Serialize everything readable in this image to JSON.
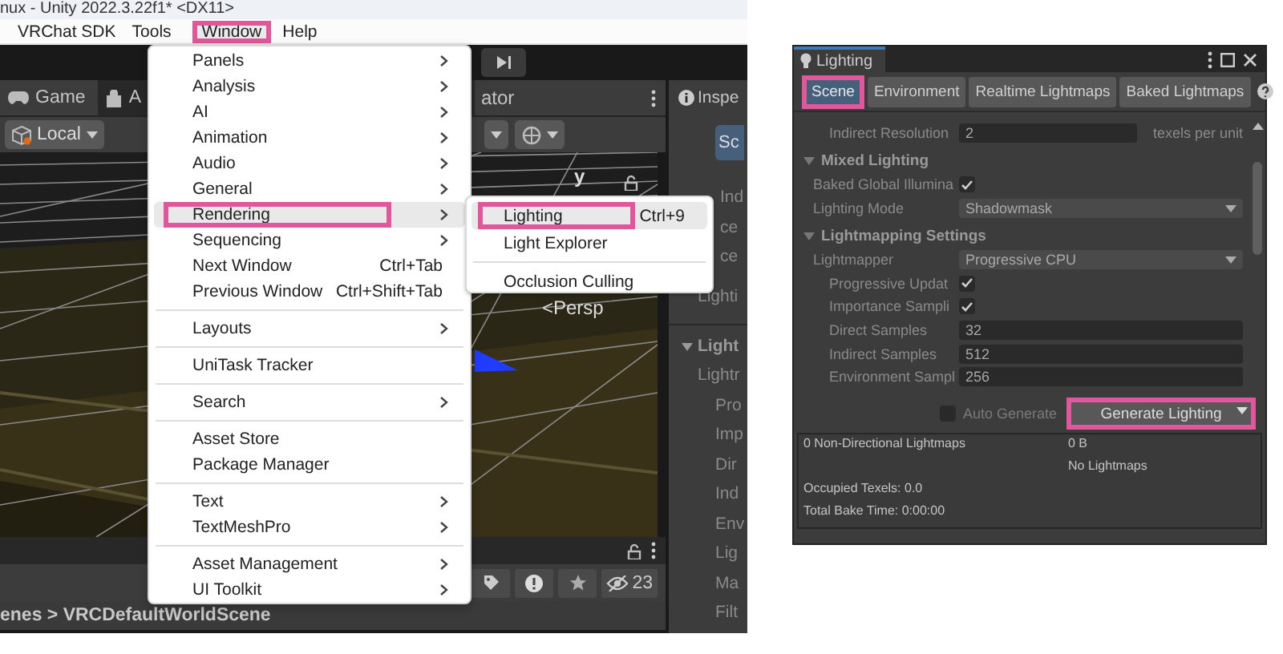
{
  "editor": {
    "title": "nux - Unity 2022.3.22f1* <DX11>",
    "menu_bar": [
      {
        "label": "VRChat SDK",
        "selected": false,
        "highlighted": false
      },
      {
        "label": "Tools",
        "selected": false,
        "highlighted": false
      },
      {
        "label": "Window",
        "selected": true,
        "highlighted": true
      },
      {
        "label": "Help",
        "selected": false,
        "highlighted": false
      }
    ],
    "game_tabs": [
      {
        "label": "Game",
        "selected": true
      },
      {
        "label": "A",
        "selected": false
      }
    ],
    "animator_tab": "ator",
    "pivot_dropdown": "Local",
    "scene_view": {
      "axis_label": "y",
      "projection": "<Persp"
    },
    "inspector": {
      "tab": "Inspe",
      "button": "Sc",
      "continued_rows": [
        {
          "kind": "text",
          "label": "Ind"
        },
        {
          "kind": "text",
          "label": "ce"
        },
        {
          "kind": "text",
          "label": "ce"
        }
      ],
      "rows": [
        {
          "kind": "text",
          "label": "Lighti"
        },
        {
          "kind": "header",
          "label": "Light",
          "expanded": true,
          "children": [
            {
              "kind": "text",
              "label": "Lightr",
              "children": [
                {
                  "kind": "text",
                  "label": "Pro"
                },
                {
                  "kind": "text",
                  "label": "Imp"
                },
                {
                  "kind": "text",
                  "label": "Dir"
                },
                {
                  "kind": "text",
                  "label": "Ind"
                },
                {
                  "kind": "text",
                  "label": "Env"
                },
                {
                  "kind": "text",
                  "label": "Lig"
                },
                {
                  "kind": "text",
                  "label": "Ma"
                },
                {
                  "kind": "text",
                  "label": "Filt"
                }
              ]
            }
          ]
        }
      ]
    },
    "hierarchy_count": "23",
    "breadcrumb": "enes > VRCDefaultWorldScene",
    "window_menu": {
      "sections": [
        [
          {
            "label": "Panels",
            "submenu": true,
            "selected": false,
            "highlighted": false
          },
          {
            "label": "Analysis",
            "submenu": true,
            "selected": false,
            "highlighted": false
          },
          {
            "label": "AI",
            "submenu": true,
            "selected": false,
            "highlighted": false
          },
          {
            "label": "Animation",
            "submenu": true,
            "selected": false,
            "highlighted": false
          },
          {
            "label": "Audio",
            "submenu": true,
            "selected": false,
            "highlighted": false
          },
          {
            "label": "General",
            "submenu": true,
            "selected": false,
            "highlighted": false
          },
          {
            "label": "Rendering",
            "submenu": true,
            "selected": true,
            "highlighted": true
          },
          {
            "label": "Sequencing",
            "submenu": true,
            "selected": false,
            "highlighted": false
          },
          {
            "label": "Next Window",
            "shortcut": "Ctrl+Tab",
            "submenu": false,
            "selected": false,
            "highlighted": false
          },
          {
            "label": "Previous Window",
            "shortcut": "Ctrl+Shift+Tab",
            "submenu": false,
            "selected": false,
            "highlighted": false
          }
        ],
        [
          {
            "label": "Layouts",
            "submenu": true,
            "selected": false,
            "highlighted": false
          }
        ],
        [
          {
            "label": "UniTask Tracker",
            "submenu": false,
            "selected": false,
            "highlighted": false
          }
        ],
        [
          {
            "label": "Search",
            "submenu": true,
            "selected": false,
            "highlighted": false
          }
        ],
        [
          {
            "label": "Asset Store",
            "submenu": false,
            "selected": false,
            "highlighted": false
          },
          {
            "label": "Package Manager",
            "submenu": false,
            "selected": false,
            "highlighted": false
          }
        ],
        [
          {
            "label": "Text",
            "submenu": true,
            "selected": false,
            "highlighted": false
          },
          {
            "label": "TextMeshPro",
            "submenu": true,
            "selected": false,
            "highlighted": false
          }
        ],
        [
          {
            "label": "Asset Management",
            "submenu": true,
            "selected": false,
            "highlighted": false
          },
          {
            "label": "UI Toolkit",
            "submenu": true,
            "selected": false,
            "highlighted": false
          }
        ]
      ]
    },
    "rendering_submenu": {
      "sections": [
        [
          {
            "label": "Lighting",
            "shortcut": "Ctrl+9",
            "submenu": false,
            "selected": true,
            "highlighted": true
          },
          {
            "label": "Light Explorer",
            "submenu": false,
            "selected": false,
            "highlighted": false
          }
        ],
        [
          {
            "label": "Occlusion Culling",
            "submenu": false,
            "selected": false,
            "highlighted": false
          }
        ]
      ]
    }
  },
  "lighting_window": {
    "title": "Lighting",
    "tabs": [
      {
        "label": "Scene",
        "selected": true,
        "highlighted": true
      },
      {
        "label": "Environment",
        "selected": false,
        "highlighted": false
      },
      {
        "label": "Realtime Lightmaps",
        "selected": false,
        "highlighted": false
      },
      {
        "label": "Baked Lightmaps",
        "selected": false,
        "highlighted": false
      }
    ],
    "continued_rows": [
      {
        "kind": "field",
        "label": "Indirect Resolution",
        "value": "2",
        "unit": "texels per unit"
      }
    ],
    "sections": [
      {
        "title": "Mixed Lighting",
        "expanded": true,
        "rows": [
          {
            "kind": "checkbox",
            "label": "Baked Global Illumina",
            "checked": true
          },
          {
            "kind": "dropdown",
            "label": "Lighting Mode",
            "value": "Shadowmask"
          }
        ]
      },
      {
        "title": "Lightmapping Settings",
        "expanded": true,
        "rows": [
          {
            "kind": "dropdown",
            "label": "Lightmapper",
            "value": "Progressive CPU",
            "children": [
              {
                "kind": "checkbox",
                "label": "Progressive Updat",
                "checked": true
              },
              {
                "kind": "checkbox",
                "label": "Importance Sampli",
                "checked": true
              },
              {
                "kind": "field",
                "label": "Direct Samples",
                "value": "32"
              },
              {
                "kind": "field",
                "label": "Indirect Samples",
                "value": "512"
              },
              {
                "kind": "field",
                "label": "Environment Sampl",
                "value": "256"
              }
            ]
          }
        ]
      }
    ],
    "auto_generate": {
      "label": "Auto Generate",
      "checked": false
    },
    "generate_button": {
      "label": "Generate Lighting",
      "highlighted": true
    },
    "stats": {
      "lightmaps": "0 Non-Directional Lightmaps",
      "size": "0 B",
      "status": "No Lightmaps",
      "occupied_texels": "Occupied Texels: 0.0",
      "bake_time": "Total Bake Time: 0:00:00"
    }
  }
}
